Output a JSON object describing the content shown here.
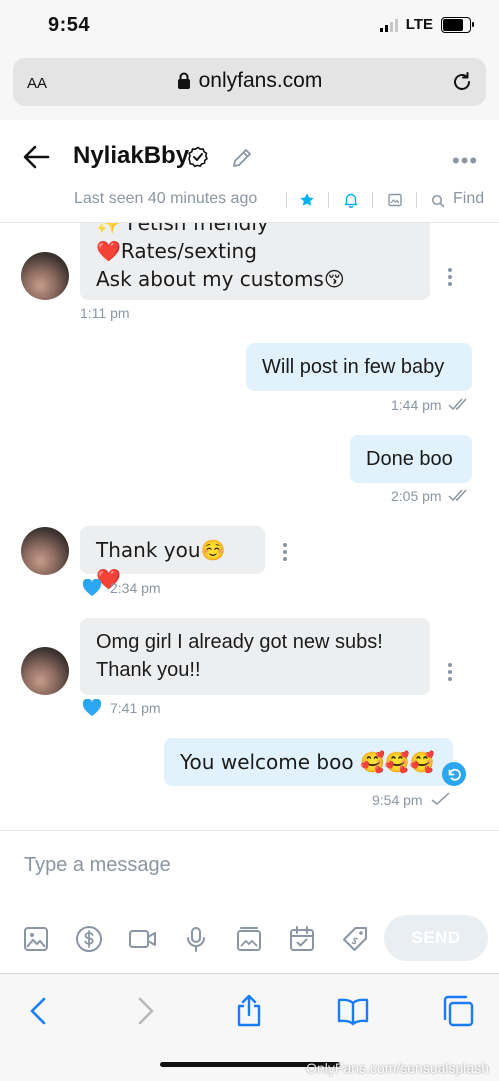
{
  "status_bar": {
    "time": "9:54",
    "network": "LTE"
  },
  "browser": {
    "aa_label": "AA",
    "url": "onlyfans.com"
  },
  "chat": {
    "name": "NyliakBby",
    "last_seen": "Last seen 40 minutes ago",
    "find_label": "Find",
    "accent_color": "#00aff0"
  },
  "messages": [
    {
      "direction": "in",
      "lines": [
        "✨ Fetish friendly",
        "❤️Rates/sexting",
        "Ask about my customs😚"
      ],
      "time": "1:11 pm",
      "liked": false
    },
    {
      "direction": "out",
      "text": "Will post in few baby",
      "time": "1:44 pm",
      "status": "read"
    },
    {
      "direction": "out",
      "text": "Done boo",
      "time": "2:05 pm",
      "status": "read"
    },
    {
      "direction": "in",
      "text": "Thank you☺️❤️",
      "time": "2:34 pm",
      "liked": true
    },
    {
      "direction": "in",
      "lines": [
        "Omg girl I already got new subs!",
        "Thank you!!"
      ],
      "time": "7:41 pm",
      "liked": true
    },
    {
      "direction": "out",
      "text": "You welcome boo 🥰🥰🥰",
      "time": "9:54 pm",
      "status": "sent"
    }
  ],
  "composer": {
    "placeholder": "Type a message",
    "send_label": "SEND"
  },
  "watermark": "OnlyFans.com/sensualsplash"
}
